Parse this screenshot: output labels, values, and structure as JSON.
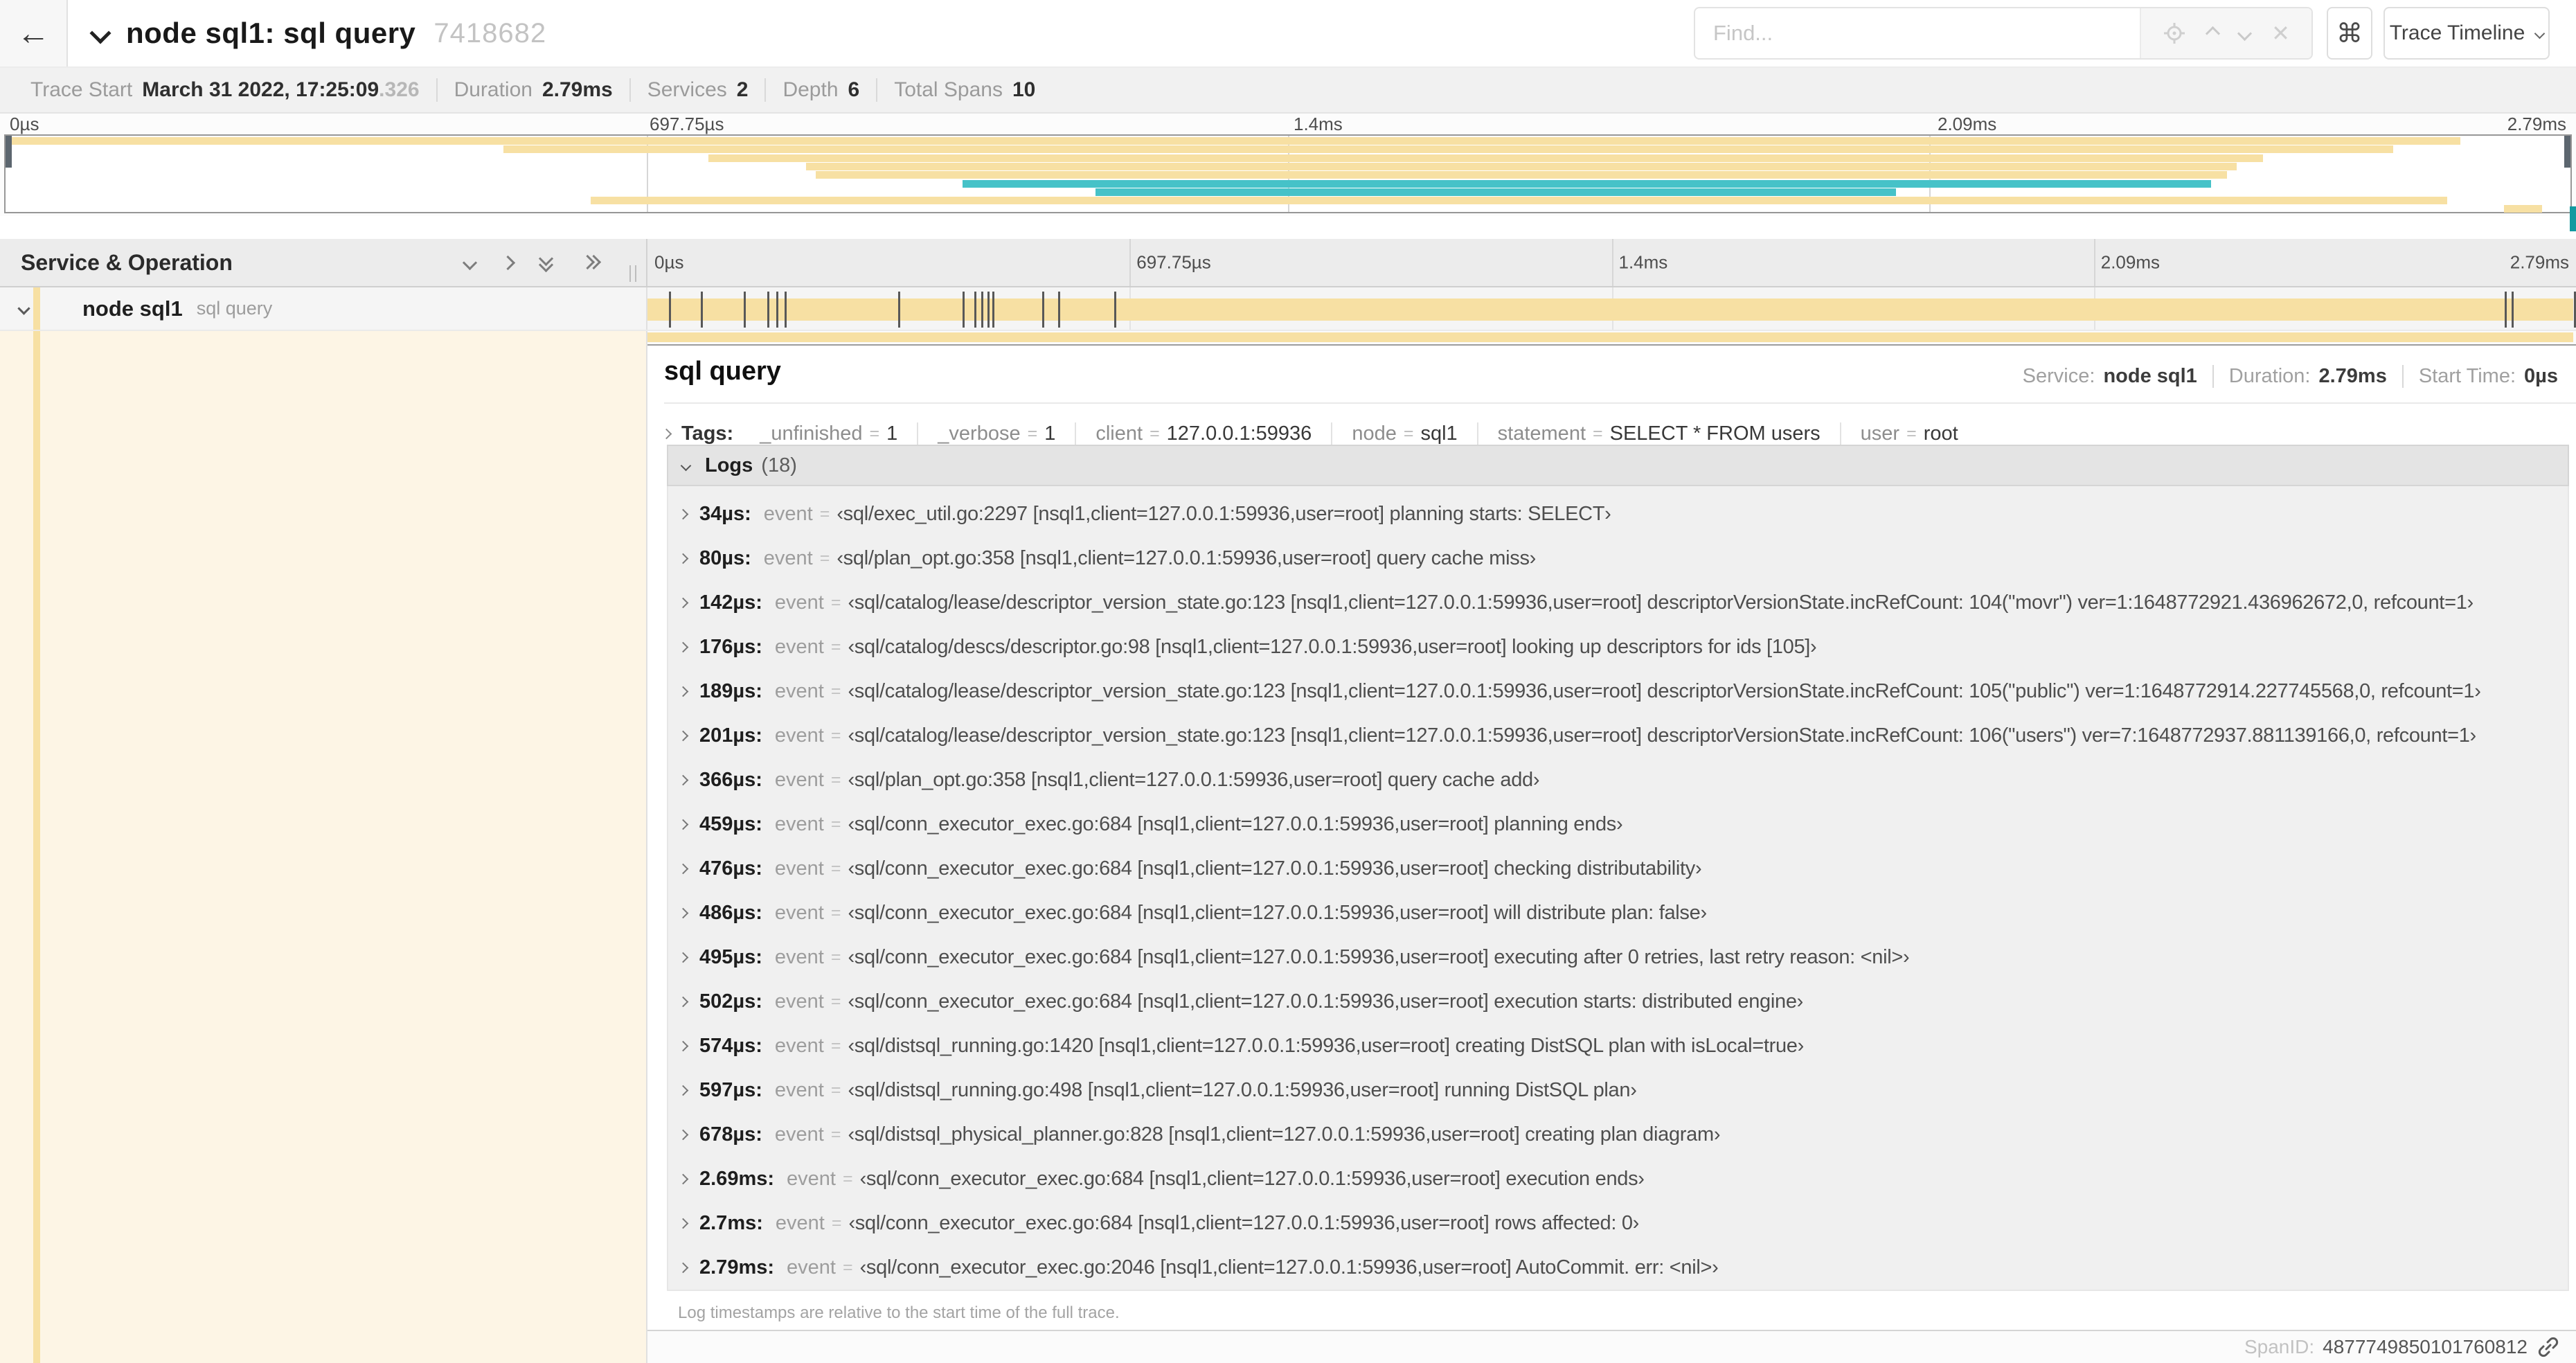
{
  "colors": {
    "span_tan": "#f7e0a3",
    "span_teal": "#46c2c8",
    "detail_cream": "#fdf5e5"
  },
  "header": {
    "back": "←",
    "title": "node sql1: sql query",
    "trace_id": "7418682",
    "find_placeholder": "Find...",
    "clear_label": "✕",
    "keyboard_shortcut": "⌘",
    "view_selector": "Trace Timeline"
  },
  "summary": {
    "items": [
      {
        "label": "Trace Start",
        "value": "March 31 2022, 17:25:09",
        "suffix": ".326"
      },
      {
        "label": "Duration",
        "value": "2.79ms"
      },
      {
        "label": "Services",
        "value": "2"
      },
      {
        "label": "Depth",
        "value": "6"
      },
      {
        "label": "Total Spans",
        "value": "10"
      }
    ]
  },
  "minimap": {
    "bars": [
      {
        "start": 0,
        "end": 95.7,
        "color": "tan"
      },
      {
        "start": 19.4,
        "end": 93.1,
        "color": "tan"
      },
      {
        "start": 27.4,
        "end": 88.0,
        "color": "tan"
      },
      {
        "start": 31.2,
        "end": 87.0,
        "color": "tan"
      },
      {
        "start": 31.6,
        "end": 86.6,
        "color": "tan"
      },
      {
        "start": 37.3,
        "end": 86.0,
        "color": "teal"
      },
      {
        "start": 42.5,
        "end": 73.7,
        "color": "teal"
      },
      {
        "start": 22.8,
        "end": 95.2,
        "color": "tan"
      },
      {
        "start": 97.4,
        "end": 98.9,
        "color": "tan"
      }
    ]
  },
  "timeline": {
    "column_header": "Service & Operation",
    "ticks": [
      "0µs",
      "697.75µs",
      "1.4ms",
      "2.09ms",
      "2.79ms"
    ],
    "grid_pcts": [
      25,
      50,
      75
    ],
    "span": {
      "service": "node sql1",
      "operation": "sql query",
      "duration_total_us": 2790,
      "log_marker_us": [
        34,
        80,
        142,
        176,
        189,
        201,
        366,
        459,
        476,
        486,
        495,
        502,
        574,
        597,
        678,
        2690,
        2700,
        2790
      ]
    }
  },
  "detail": {
    "title": "sql query",
    "meta": [
      {
        "label": "Service:",
        "value": "node sql1"
      },
      {
        "label": "Duration:",
        "value": "2.79ms"
      },
      {
        "label": "Start Time:",
        "value": "0µs"
      }
    ],
    "tags_label": "Tags:",
    "eq": "=",
    "tags": [
      {
        "key": "_unfinished",
        "value": "1"
      },
      {
        "key": "_verbose",
        "value": "1"
      },
      {
        "key": "client",
        "value": "127.0.0.1:59936"
      },
      {
        "key": "node",
        "value": "sql1"
      },
      {
        "key": "statement",
        "value": "SELECT * FROM users"
      },
      {
        "key": "user",
        "value": "root"
      }
    ],
    "logs_label": "Logs",
    "logs_count": "(18)",
    "logs": [
      {
        "time": "34µs:",
        "key": "event",
        "value": "‹sql/exec_util.go:2297 [nsql1,client=127.0.0.1:59936,user=root] planning starts: SELECT›"
      },
      {
        "time": "80µs:",
        "key": "event",
        "value": "‹sql/plan_opt.go:358 [nsql1,client=127.0.0.1:59936,user=root] query cache miss›"
      },
      {
        "time": "142µs:",
        "key": "event",
        "value": "‹sql/catalog/lease/descriptor_version_state.go:123 [nsql1,client=127.0.0.1:59936,user=root] descriptorVersionState.incRefCount: 104(\"movr\") ver=1:1648772921.436962672,0, refcount=1›"
      },
      {
        "time": "176µs:",
        "key": "event",
        "value": "‹sql/catalog/descs/descriptor.go:98 [nsql1,client=127.0.0.1:59936,user=root] looking up descriptors for ids [105]›"
      },
      {
        "time": "189µs:",
        "key": "event",
        "value": "‹sql/catalog/lease/descriptor_version_state.go:123 [nsql1,client=127.0.0.1:59936,user=root] descriptorVersionState.incRefCount: 105(\"public\") ver=1:1648772914.227745568,0, refcount=1›"
      },
      {
        "time": "201µs:",
        "key": "event",
        "value": "‹sql/catalog/lease/descriptor_version_state.go:123 [nsql1,client=127.0.0.1:59936,user=root] descriptorVersionState.incRefCount: 106(\"users\") ver=7:1648772937.881139166,0, refcount=1›"
      },
      {
        "time": "366µs:",
        "key": "event",
        "value": "‹sql/plan_opt.go:358 [nsql1,client=127.0.0.1:59936,user=root] query cache add›"
      },
      {
        "time": "459µs:",
        "key": "event",
        "value": "‹sql/conn_executor_exec.go:684 [nsql1,client=127.0.0.1:59936,user=root] planning ends›"
      },
      {
        "time": "476µs:",
        "key": "event",
        "value": "‹sql/conn_executor_exec.go:684 [nsql1,client=127.0.0.1:59936,user=root] checking distributability›"
      },
      {
        "time": "486µs:",
        "key": "event",
        "value": "‹sql/conn_executor_exec.go:684 [nsql1,client=127.0.0.1:59936,user=root] will distribute plan: false›"
      },
      {
        "time": "495µs:",
        "key": "event",
        "value": "‹sql/conn_executor_exec.go:684 [nsql1,client=127.0.0.1:59936,user=root] executing after 0 retries, last retry reason: <nil>›"
      },
      {
        "time": "502µs:",
        "key": "event",
        "value": "‹sql/conn_executor_exec.go:684 [nsql1,client=127.0.0.1:59936,user=root] execution starts: distributed engine›"
      },
      {
        "time": "574µs:",
        "key": "event",
        "value": "‹sql/distsql_running.go:1420 [nsql1,client=127.0.0.1:59936,user=root] creating DistSQL plan with isLocal=true›"
      },
      {
        "time": "597µs:",
        "key": "event",
        "value": "‹sql/distsql_running.go:498 [nsql1,client=127.0.0.1:59936,user=root] running DistSQL plan›"
      },
      {
        "time": "678µs:",
        "key": "event",
        "value": "‹sql/distsql_physical_planner.go:828 [nsql1,client=127.0.0.1:59936,user=root] creating plan diagram›"
      },
      {
        "time": "2.69ms:",
        "key": "event",
        "value": "‹sql/conn_executor_exec.go:684 [nsql1,client=127.0.0.1:59936,user=root] execution ends›"
      },
      {
        "time": "2.7ms:",
        "key": "event",
        "value": "‹sql/conn_executor_exec.go:684 [nsql1,client=127.0.0.1:59936,user=root] rows affected: 0›"
      },
      {
        "time": "2.79ms:",
        "key": "event",
        "value": "‹sql/conn_executor_exec.go:2046 [nsql1,client=127.0.0.1:59936,user=root] AutoCommit. err: <nil>›"
      }
    ],
    "note": "Log timestamps are relative to the start time of the full trace.",
    "spanid_label": "SpanID:",
    "spanid": "4877749850101760812"
  }
}
